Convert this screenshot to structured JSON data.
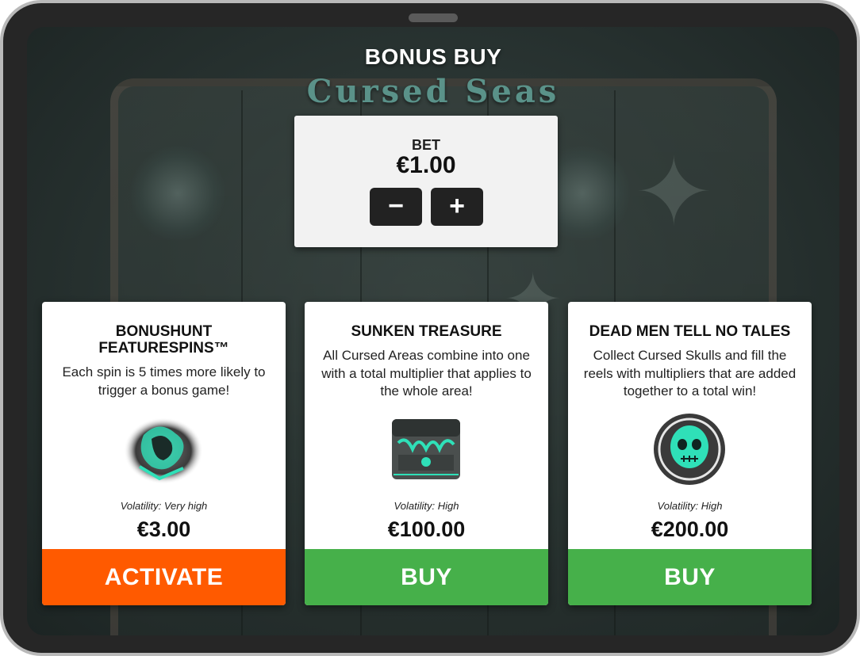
{
  "heading": "BONUS BUY",
  "game_logo": "Cursed Seas",
  "bet": {
    "label": "BET",
    "value": "€1.00",
    "decrease_label": "−",
    "increase_label": "+"
  },
  "cards": [
    {
      "title": "BONUSHUNT FEATURESPINS™",
      "description": "Each spin is 5 times more likely to trigger a bonus game!",
      "icon": "spirit-chest-icon",
      "volatility": "Volatility: Very high",
      "price": "€3.00",
      "button_label": "ACTIVATE",
      "button_color": "#ff5a00"
    },
    {
      "title": "SUNKEN TREASURE",
      "description": "All Cursed Areas combine into one with a total multiplier that applies to the whole area!",
      "icon": "treasure-chest-icon",
      "volatility": "Volatility: High",
      "price": "€100.00",
      "button_label": "BUY",
      "button_color": "#46b04a"
    },
    {
      "title": "DEAD MEN TELL NO TALES",
      "description": "Collect Cursed Skulls and fill the reels with multipliers that are added together to a total win!",
      "icon": "cursed-skull-icon",
      "volatility": "Volatility: High",
      "price": "€200.00",
      "button_label": "BUY",
      "button_color": "#46b04a"
    }
  ],
  "colors": {
    "activate": "#ff5a00",
    "buy": "#46b04a",
    "accent_teal": "#2fe0b8"
  }
}
